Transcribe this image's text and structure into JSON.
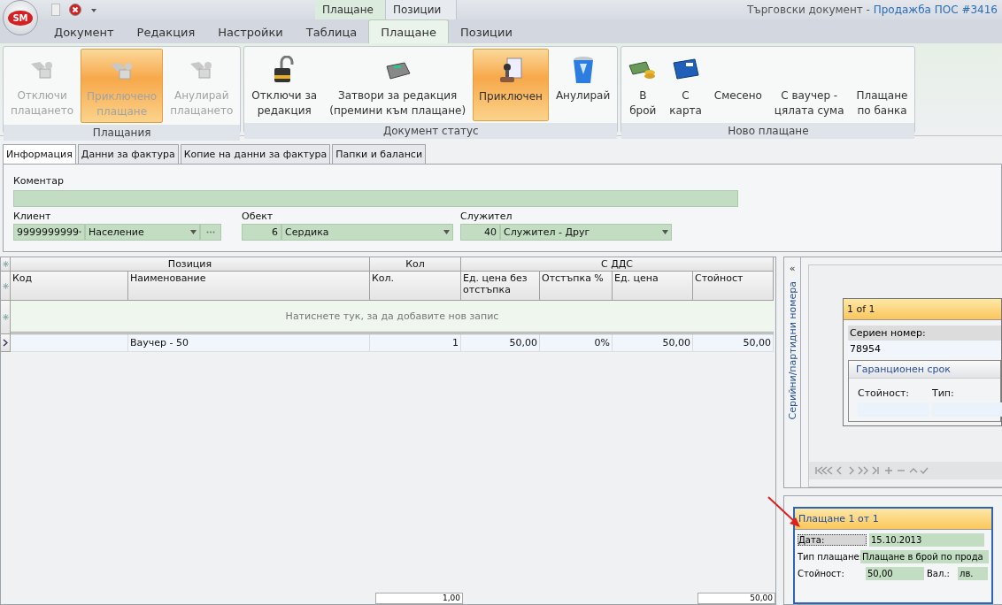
{
  "window": {
    "title": "Търговски документ - ",
    "document": "Продажба ПОС #3416",
    "logo": "SM"
  },
  "context_tabs": [
    {
      "label": "Плащане",
      "selected": true
    },
    {
      "label": "Позиции",
      "selected": false
    }
  ],
  "ribbon_tabs": [
    {
      "label": "Документ",
      "selected": false
    },
    {
      "label": "Редакция",
      "selected": false
    },
    {
      "label": "Настройки",
      "selected": false
    },
    {
      "label": "Таблица",
      "selected": false
    },
    {
      "label": "Плащане",
      "selected": true
    },
    {
      "label": "Позиции",
      "selected": false
    }
  ],
  "ribbon_groups": [
    {
      "title": "Плащания",
      "buttons": [
        {
          "label": "Отключи\nплащането",
          "disabled": true,
          "selected": false
        },
        {
          "label": "Приключено\nплащане",
          "disabled": true,
          "selected": true
        },
        {
          "label": "Анулирай\nплащането",
          "disabled": true,
          "selected": false
        }
      ]
    },
    {
      "title": "Документ статус",
      "buttons": [
        {
          "label": "Отключи за\nредакция",
          "disabled": false,
          "selected": false
        },
        {
          "label": "Затвори за редакция\n(премини към плащане)",
          "disabled": false,
          "selected": false
        },
        {
          "label": "Приключен",
          "disabled": false,
          "selected": true
        },
        {
          "label": "Анулирай",
          "disabled": false,
          "selected": false
        }
      ]
    },
    {
      "title": "Ново плащане",
      "buttons": [
        {
          "label": "В\nброй",
          "disabled": false,
          "selected": false
        },
        {
          "label": "С\nкарта",
          "disabled": false,
          "selected": false
        },
        {
          "label": "Смесено",
          "disabled": false,
          "selected": false
        },
        {
          "label": "С ваучер -\nцялата сума",
          "disabled": false,
          "selected": false
        },
        {
          "label": "Плащане\nпо банка",
          "disabled": false,
          "selected": false
        }
      ]
    }
  ],
  "doc_tabs": [
    {
      "label": "Информация",
      "selected": true
    },
    {
      "label": "Данни за фактура",
      "selected": false
    },
    {
      "label": "Копие на данни за фактура",
      "selected": false
    },
    {
      "label": "Папки и баланси",
      "selected": false
    }
  ],
  "info": {
    "comment_label": "Коментар",
    "client": {
      "label": "Клиент",
      "code": "9999999999",
      "name": "Население"
    },
    "object": {
      "label": "Обект",
      "code": "6",
      "name": "Сердика"
    },
    "employee": {
      "label": "Служител",
      "code": "40",
      "name": "Служител - Друг"
    }
  },
  "grid": {
    "bands": [
      {
        "label": "Позиция",
        "columns": [
          "Код",
          "Наименование"
        ]
      },
      {
        "label": "Кол",
        "columns": [
          "Кол."
        ]
      },
      {
        "label": "С ДДС",
        "columns": [
          "Ед. цена без отстъпка",
          "Отстъпка %",
          "Ед. цена",
          "Стойност"
        ]
      }
    ],
    "new_row_hint": "Натиснете тук, за да добавите нов запис",
    "rows": [
      {
        "cells": [
          "",
          "Ваучер - 50",
          "1",
          "50,00",
          "0%",
          "50,00",
          "50,00"
        ],
        "current": true
      }
    ],
    "totals": [
      "1,00",
      "50,00"
    ]
  },
  "side_panel": {
    "title": "Серийни/партидни номера",
    "collapse": "«",
    "card_header": "1 of 1",
    "serial_label": "Сериен номер:",
    "serial_value": "78954",
    "warranty": {
      "title": "Гаранционен срок",
      "value_label": "Стойност:",
      "type_label": "Тип:"
    }
  },
  "payment": {
    "header": "Плащане 1 от 1",
    "date_label": "Дата:",
    "date": "15.10.2013",
    "type_label": "Тип плащане:",
    "type": "Плащане в брой по прода",
    "amount_label": "Стойност:",
    "amount": "50,00",
    "currency_label": "Вал.:",
    "currency": "лв."
  }
}
